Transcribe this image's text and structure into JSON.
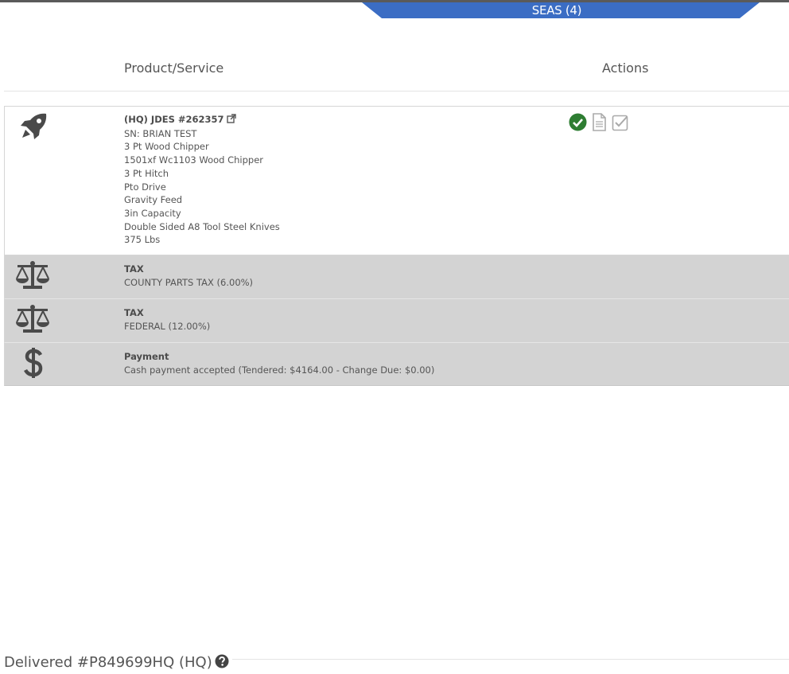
{
  "tab": {
    "label": "SEAS (4)",
    "color": "#3b6dc4"
  },
  "table": {
    "headers": {
      "product": "Product/Service",
      "actions": "Actions"
    },
    "item": {
      "icon": "rocket-icon",
      "title": "(HQ)  JDES #262357",
      "lines": [
        "SN: BRIAN TEST",
        "3 Pt Wood Chipper",
        "1501xf Wc1103 Wood Chipper",
        "3 Pt Hitch",
        "Pto Drive",
        "Gravity Feed",
        "3in Capacity",
        "Double Sided A8 Tool Steel Knives",
        "375 Lbs"
      ],
      "actions": [
        "check-circle-icon",
        "document-icon",
        "checkbox-icon"
      ]
    },
    "taxes": [
      {
        "icon": "scale-icon",
        "title": "TAX",
        "detail": "COUNTY PARTS TAX (6.00%)"
      },
      {
        "icon": "scale-icon",
        "title": "TAX",
        "detail": "FEDERAL (12.00%)"
      }
    ],
    "payment": {
      "icon": "dollar-icon",
      "title": "Payment",
      "detail": "Cash payment accepted (Tendered: $4164.00 - Change Due: $0.00)"
    }
  },
  "footer": {
    "label": "Delivered #P849699HQ (HQ)"
  },
  "colors": {
    "success": "#2e7d32",
    "row_gray": "#d3d3d3",
    "icon_dark": "#4a4a4a"
  }
}
